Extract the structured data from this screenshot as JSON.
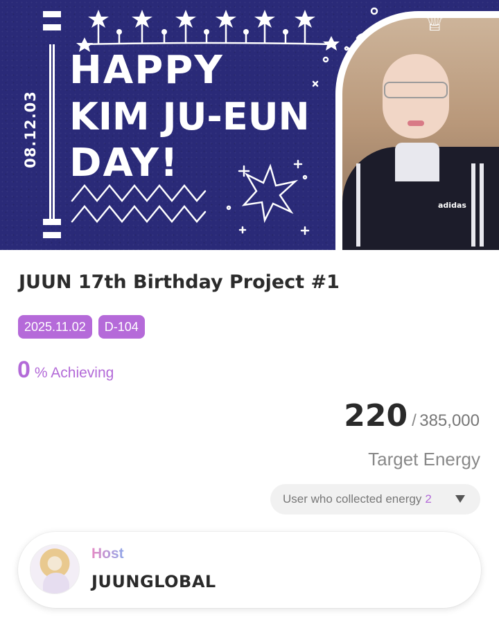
{
  "banner": {
    "date": "08.12.03",
    "line1": "HAPPY",
    "line2": "KIM JU-EUN",
    "line3": "DAY!",
    "jacket_logo": "adidas"
  },
  "project": {
    "title": "JUUN 17th Birthday Project #1",
    "date_tag": "2025.11.02",
    "dday_tag": "D-104"
  },
  "progress": {
    "percent": "0",
    "achieving_label": "% Achieving"
  },
  "energy": {
    "current": "220",
    "separator": "/",
    "target": "385,000",
    "target_label": "Target Energy"
  },
  "collectors": {
    "label": "User who collected energy",
    "count": "2"
  },
  "host": {
    "label": "Host",
    "name": "JUUNGLOBAL"
  },
  "colors": {
    "accent": "#b36ad8",
    "banner_bg": "#2a2a78"
  }
}
